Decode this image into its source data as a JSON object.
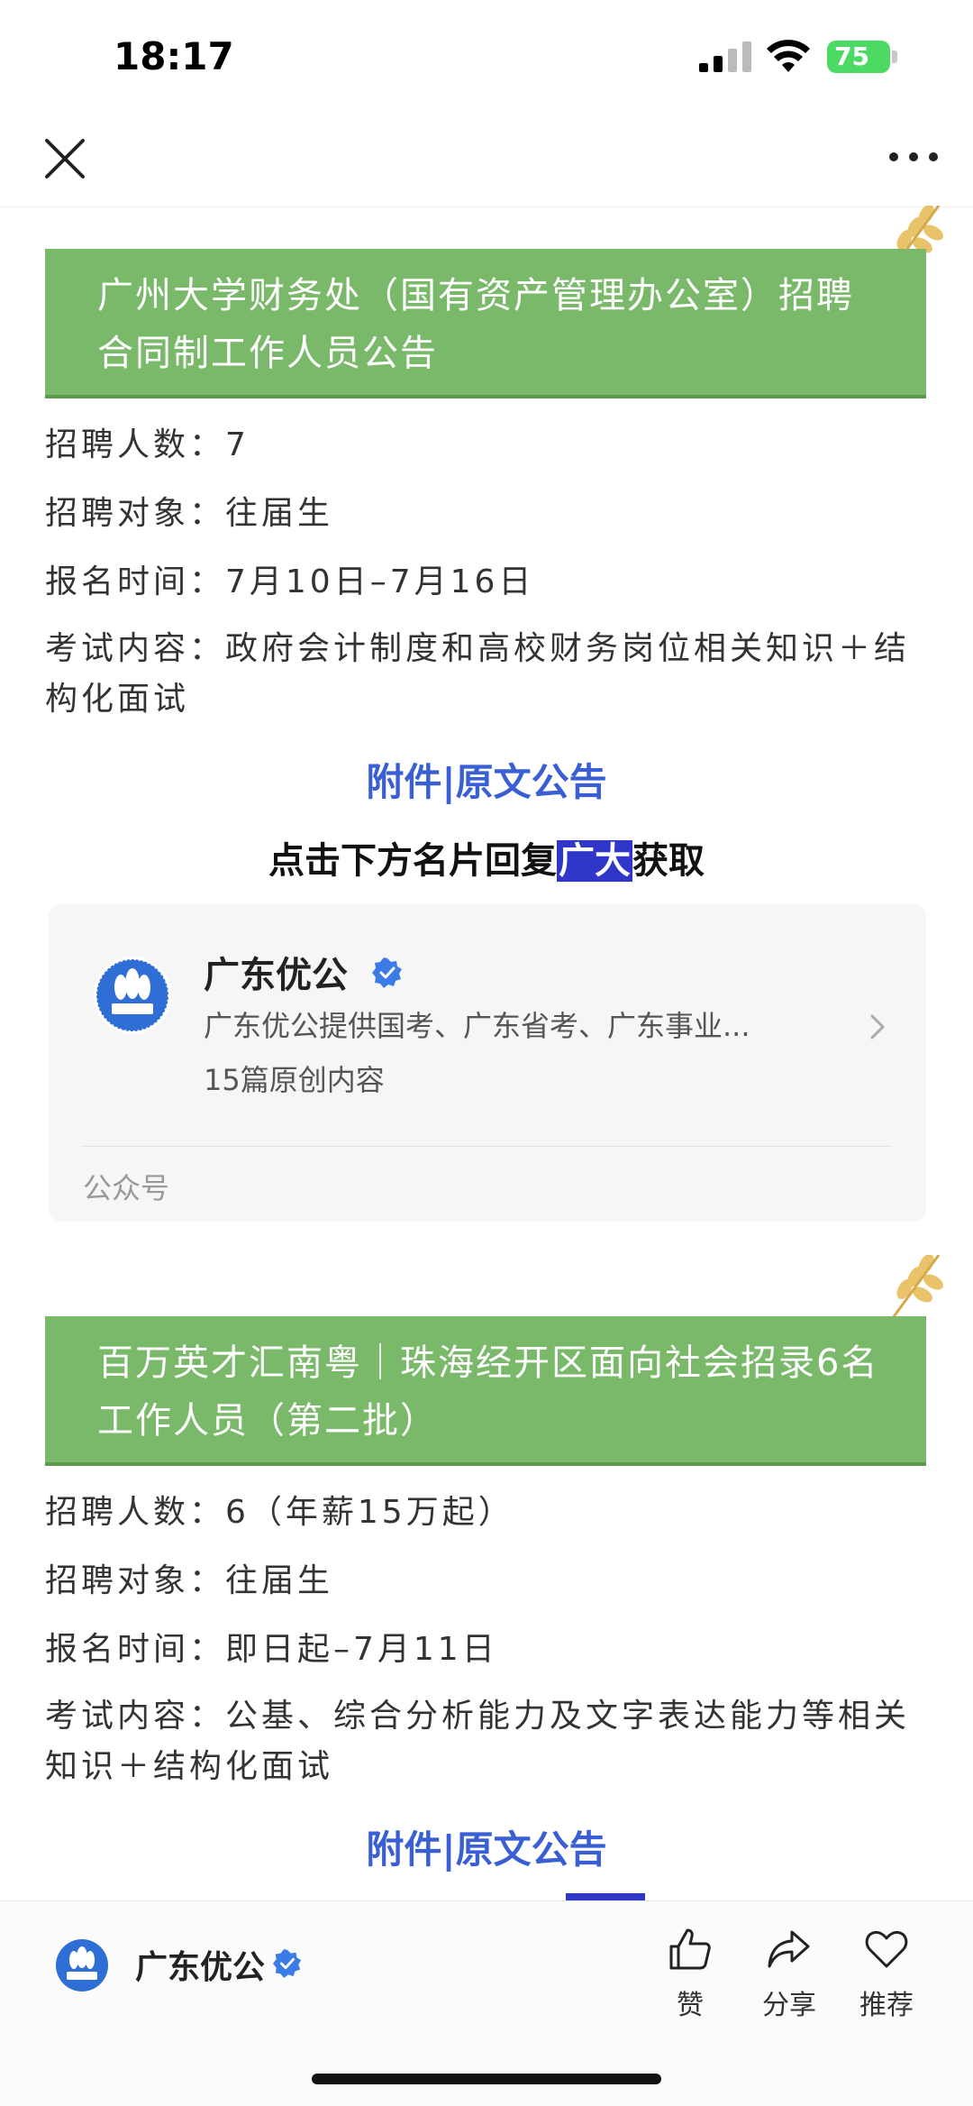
{
  "status_bar": {
    "time": "18:17",
    "battery": "75"
  },
  "colors": {
    "title_bg": "#7ab86a",
    "link": "#3a5fd4",
    "highlight": "#2f36c8"
  },
  "sections": [
    {
      "title": "广州大学财务处（国有资产管理办公室）招聘合同制工作人员公告",
      "rows": [
        "招聘人数：7",
        "招聘对象：往届生",
        "报名时间：7月10日–7月16日",
        "考试内容：政府会计制度和高校财务岗位相关知识＋结构化面试"
      ],
      "link": "附件|原文公告"
    },
    {
      "title": "百万英才汇南粤｜珠海经开区面向社会招录6名工作人员（第二批）",
      "rows": [
        "招聘人数：6（年薪15万起）",
        "招聘对象：往届生",
        "报名时间：即日起–7月11日",
        "考试内容：公基、综合分析能力及文字表达能力等相关知识＋结构化面试"
      ],
      "link": "附件|原文公告"
    }
  ],
  "reply_prompt": {
    "before": "点击下方名片回复",
    "keyword": "广大",
    "after": "获取"
  },
  "account_card": {
    "name": "广东优公",
    "description": "广东优公提供国考、广东省考、广东事业...",
    "count": "15篇原创内容",
    "type": "公众号"
  },
  "bottom_bar": {
    "account_name": "广东优公",
    "like": "赞",
    "share": "分享",
    "recommend": "推荐"
  },
  "icons": [
    "close-icon",
    "more-icon",
    "wheat-icon",
    "verified-icon",
    "chevron-right-icon",
    "thumbs-up-icon",
    "share-icon",
    "heart-icon"
  ]
}
